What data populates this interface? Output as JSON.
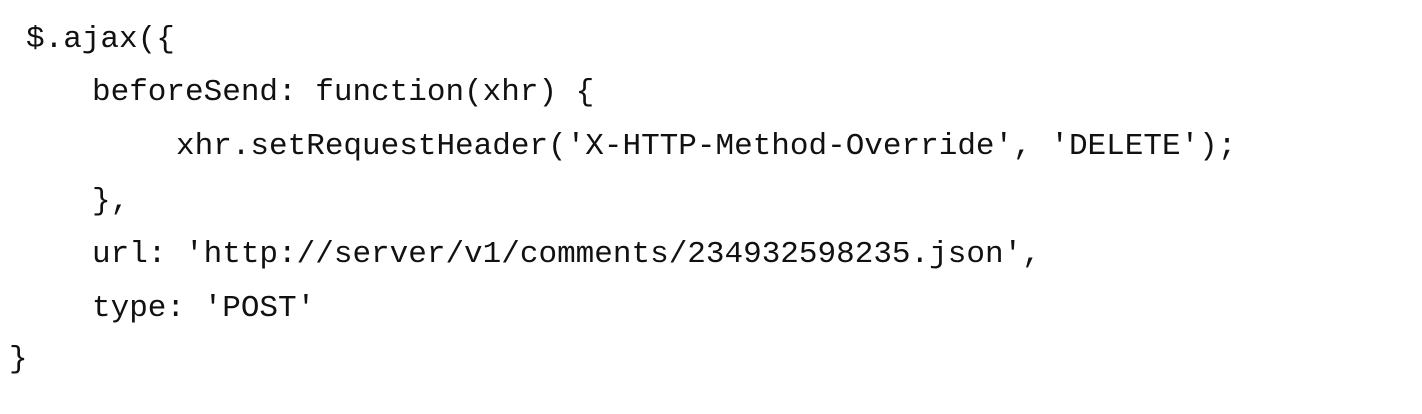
{
  "code": {
    "lines": [
      "$.ajax({",
      "beforeSend: function(xhr) {",
      "xhr.setRequestHeader('X-HTTP-Method-Override', 'DELETE');",
      "},",
      "url: 'http://server/v1/comments/234932598235.json',",
      "type: 'POST'",
      "}"
    ]
  }
}
